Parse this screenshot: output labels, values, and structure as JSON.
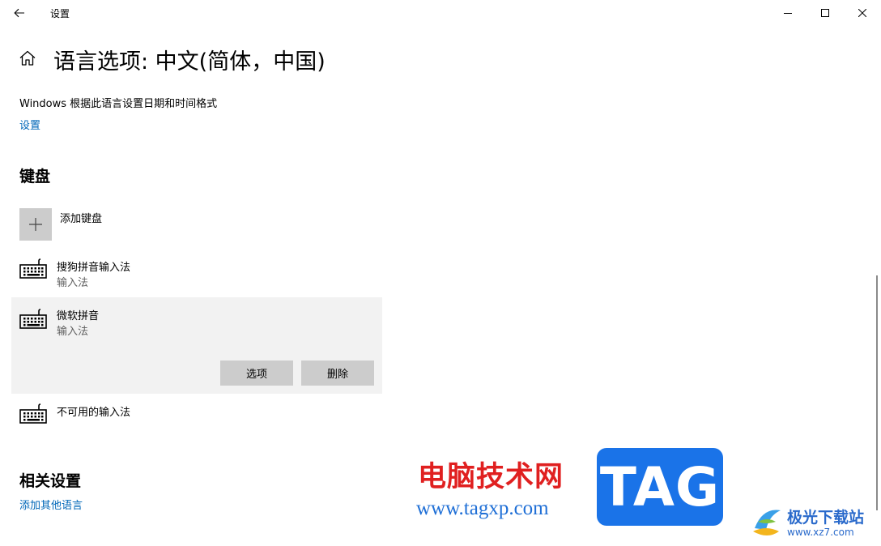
{
  "window": {
    "title": "设置"
  },
  "page": {
    "title": "语言选项: 中文(简体，中国)",
    "regional_desc": "Windows 根据此语言设置日期和时间格式",
    "regional_link": "设置"
  },
  "keyboard": {
    "section_title": "键盘",
    "add_label": "添加键盘",
    "items": [
      {
        "name": "搜狗拼音输入法",
        "type": "输入法"
      },
      {
        "name": "微软拼音",
        "type": "输入法",
        "options_label": "选项",
        "remove_label": "删除"
      },
      {
        "name": "不可用的输入法"
      }
    ]
  },
  "related": {
    "section_title": "相关设置",
    "add_language_link": "添加其他语言"
  },
  "watermark": {
    "site_name": "电脑技术网",
    "site_url": "www.tagxp.com",
    "tag_text": "TAG",
    "logo2_name": "极光下载站",
    "logo2_url": "www.xz7.com"
  },
  "colors": {
    "link": "#0067b8",
    "selected_bg": "#f2f2f2",
    "button_bg": "#cccccc",
    "watermark_red": "#e02020",
    "watermark_blue": "#1a73e8"
  },
  "icons": {
    "back": "back-arrow-icon",
    "home": "home-icon",
    "keyboard": "keyboard-icon",
    "add": "plus-icon",
    "minimize": "minimize-icon",
    "maximize": "maximize-icon",
    "close": "close-icon"
  }
}
